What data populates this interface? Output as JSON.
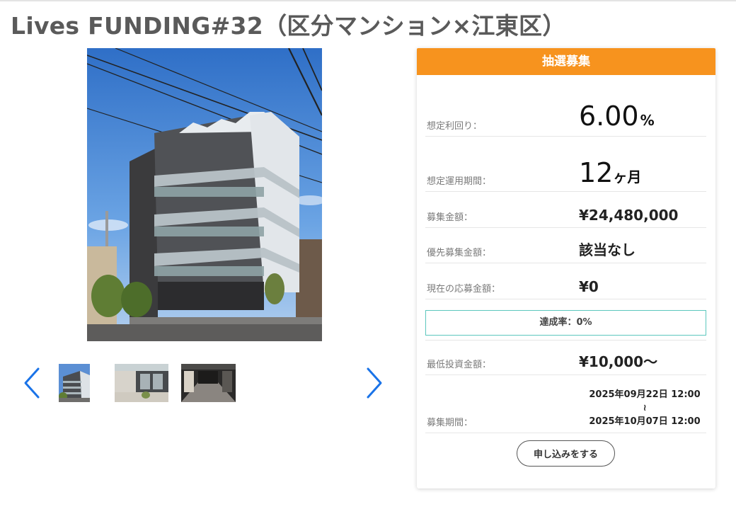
{
  "page": {
    "title": "Lives FUNDING#32（区分マンション×江東区）"
  },
  "gallery": {
    "prev_icon": "chevron-left-icon",
    "next_icon": "chevron-right-icon",
    "thumbnail_count": 3,
    "accent_color": "#1a73e8"
  },
  "panel": {
    "status": "抽選募集",
    "status_color": "#f7931e",
    "yield": {
      "label": "想定利回り：",
      "value": "6.00",
      "unit": "%"
    },
    "term": {
      "label": "想定運用期間：",
      "value": "12",
      "unit": "ヶ月"
    },
    "amount": {
      "label": "募集金額：",
      "value": "¥24,480,000"
    },
    "priority_amount": {
      "label": "優先募集金額：",
      "value": "該当なし"
    },
    "current_amount": {
      "label": "現在の応募金額：",
      "value": "¥0"
    },
    "progress": {
      "text": "達成率：0%",
      "fraction": 0.0,
      "color": "#5cc7bd"
    },
    "min_investment": {
      "label": "最低投資金額：",
      "value": "¥10,000〜"
    },
    "period": {
      "label": "募集期間：",
      "start": "2025年09月22日 12:00",
      "separator": "≀",
      "end": "2025年10月07日 12:00"
    },
    "apply_button": "申し込みをする"
  }
}
